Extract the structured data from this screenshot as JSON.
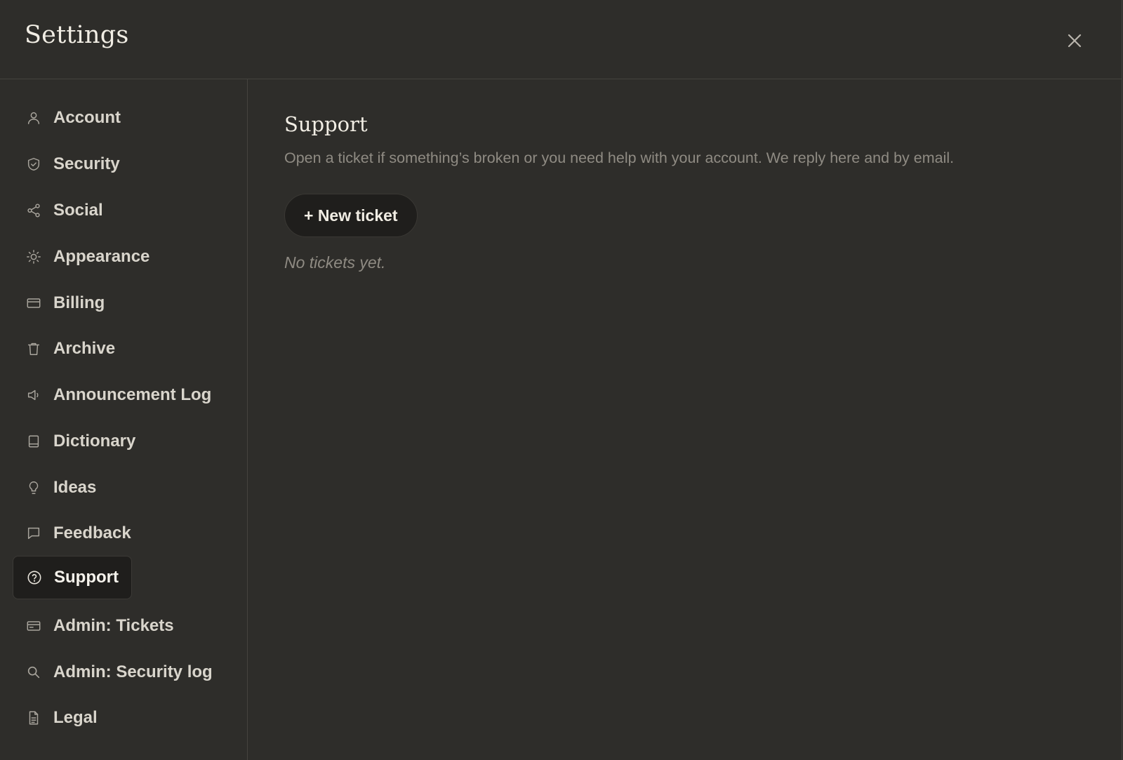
{
  "window": {
    "title": "Settings",
    "close_icon": "close-icon"
  },
  "sidebar": {
    "items": [
      {
        "label": "Account",
        "icon": "person-icon",
        "active": false
      },
      {
        "label": "Security",
        "icon": "shield-icon",
        "active": false
      },
      {
        "label": "Social",
        "icon": "share-icon",
        "active": false
      },
      {
        "label": "Appearance",
        "icon": "sun-icon",
        "active": false
      },
      {
        "label": "Billing",
        "icon": "credit-card-icon",
        "active": false
      },
      {
        "label": "Archive",
        "icon": "trash-icon",
        "active": false
      },
      {
        "label": "Announcement Log",
        "icon": "speaker-icon",
        "active": false
      },
      {
        "label": "Dictionary",
        "icon": "book-icon",
        "active": false
      },
      {
        "label": "Ideas",
        "icon": "lightbulb-icon",
        "active": false
      },
      {
        "label": "Feedback",
        "icon": "message-icon",
        "active": false
      },
      {
        "label": "Support",
        "icon": "help-circle-icon",
        "active": true
      },
      {
        "label": "Admin: Tickets",
        "icon": "ticket-icon",
        "active": false
      },
      {
        "label": "Admin: Security log",
        "icon": "search-icon",
        "active": false
      },
      {
        "label": "Legal",
        "icon": "document-icon",
        "active": false
      }
    ]
  },
  "main": {
    "title": "Support",
    "description": "Open a ticket if something’s broken or you need help with your account. We reply here and by email.",
    "new_ticket_label": "+ New ticket",
    "empty_state": "No tickets yet."
  },
  "colors": {
    "background": "#2e2d2a",
    "active_background": "#1f1e1c",
    "text_primary": "#f1ede4",
    "text_secondary": "#8f8b83",
    "divider": "#45433f"
  }
}
